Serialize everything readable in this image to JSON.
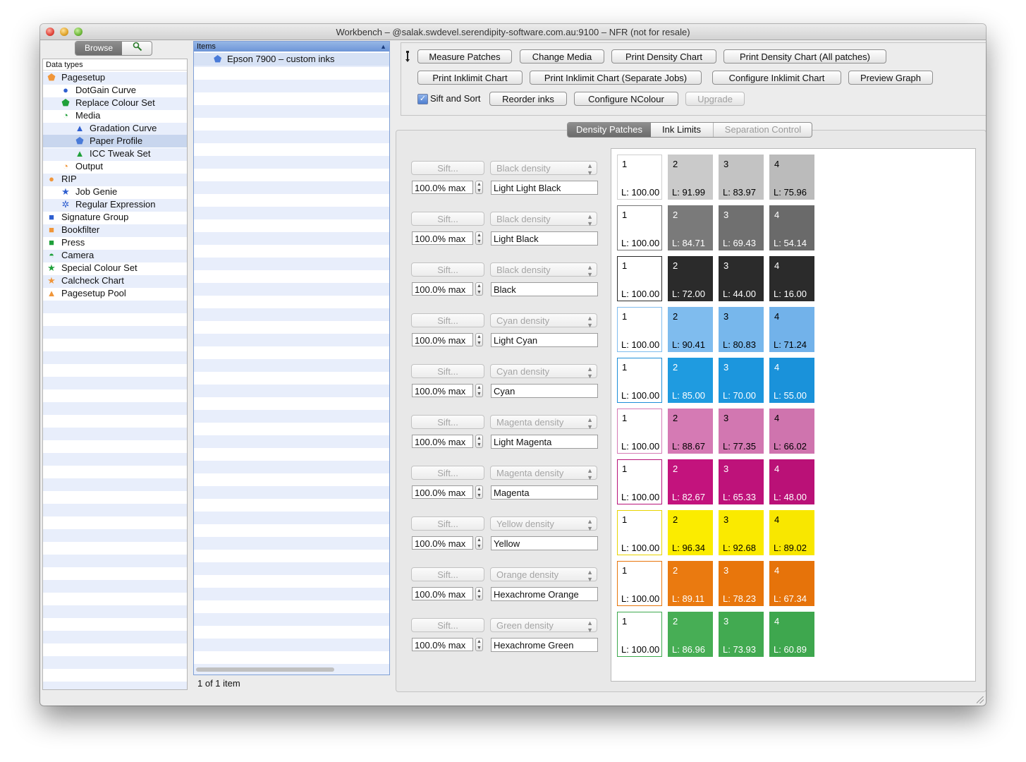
{
  "window": {
    "title": "Workbench – @salak.swdevel.serendipity-software.com.au:9100 – NFR (not for resale)"
  },
  "sidebar": {
    "browse_label": "Browse",
    "search_icon": "magnifier-icon",
    "header": "Data types",
    "items": [
      {
        "label": "Pagesetup",
        "level": 0,
        "icon": "pentagon",
        "color": "#f0963a"
      },
      {
        "label": "DotGain Curve",
        "level": 1,
        "icon": "circle",
        "color": "#2f5fd0"
      },
      {
        "label": "Replace Colour Set",
        "level": 1,
        "icon": "pentagon",
        "color": "#1fa03a"
      },
      {
        "label": "Media",
        "level": 1,
        "icon": "crescent",
        "color": "#1fa03a"
      },
      {
        "label": "Gradation Curve",
        "level": 2,
        "icon": "triangle",
        "color": "#2f5fd0"
      },
      {
        "label": "Paper Profile",
        "level": 2,
        "icon": "pentagon",
        "color": "#4a7bd8",
        "selected": true
      },
      {
        "label": "ICC Tweak Set",
        "level": 2,
        "icon": "triangle",
        "color": "#1fa03a"
      },
      {
        "label": "Output",
        "level": 1,
        "icon": "crescent",
        "color": "#f0963a"
      },
      {
        "label": "RIP",
        "level": 0,
        "icon": "circle",
        "color": "#f0963a"
      },
      {
        "label": "Job Genie",
        "level": 1,
        "icon": "star",
        "color": "#2f5fd0"
      },
      {
        "label": "Regular Expression",
        "level": 1,
        "icon": "asterisk",
        "color": "#2f5fd0"
      },
      {
        "label": "Signature Group",
        "level": 0,
        "icon": "square",
        "color": "#2f5fd0"
      },
      {
        "label": "Bookfilter",
        "level": 0,
        "icon": "square",
        "color": "#f0963a"
      },
      {
        "label": "Press",
        "level": 0,
        "icon": "square",
        "color": "#1fa03a"
      },
      {
        "label": "Camera",
        "level": 0,
        "icon": "half-circle",
        "color": "#1fa03a"
      },
      {
        "label": "Special Colour Set",
        "level": 0,
        "icon": "star",
        "color": "#1fa03a"
      },
      {
        "label": "Calcheck Chart",
        "level": 0,
        "icon": "star",
        "color": "#f0963a"
      },
      {
        "label": "Pagesetup Pool",
        "level": 0,
        "icon": "triangle",
        "color": "#f0963a"
      }
    ]
  },
  "items_pane": {
    "header": "Items",
    "rows": [
      {
        "label": "Epson 7900 – custom inks",
        "icon": "pentagon",
        "color": "#4a7bd8"
      }
    ],
    "count_text": "1 of 1 item"
  },
  "toolbar": {
    "pin_icon": "pin-icon",
    "buttons_row1": [
      "Measure Patches",
      "Change Media",
      "Print Density Chart",
      "Print Density Chart (All patches)"
    ],
    "buttons_row2": [
      "Print Inklimit Chart",
      "Print Inklimit Chart (Separate Jobs)",
      "Configure Inklimit Chart",
      "Preview Graph"
    ],
    "sift_sort_label": "Sift and Sort",
    "sift_sort_checked": true,
    "reorder_label": "Reorder inks",
    "configure_ncolour_label": "Configure NColour",
    "upgrade_label": "Upgrade"
  },
  "tabs": [
    "Density Patches",
    "Ink Limits",
    "Separation Control"
  ],
  "active_tab": "Density Patches",
  "inks": [
    {
      "sift": "Sift...",
      "density": "Black density",
      "max": "100.0% max",
      "name": "Light Light Black",
      "border": "#cfcfcf",
      "patches": [
        {
          "num": "1",
          "l": "L: 100.00",
          "bg": "#ffffff",
          "fg": "#000000"
        },
        {
          "num": "2",
          "l": "L: 91.99",
          "bg": "#cacaca",
          "fg": "#000000"
        },
        {
          "num": "3",
          "l": "L: 83.97",
          "bg": "#c3c3c3",
          "fg": "#000000"
        },
        {
          "num": "4",
          "l": "L: 75.96",
          "bg": "#bbbbbb",
          "fg": "#000000"
        }
      ]
    },
    {
      "sift": "Sift...",
      "density": "Black density",
      "max": "100.0% max",
      "name": "Light Black",
      "border": "#777777",
      "patches": [
        {
          "num": "1",
          "l": "L: 100.00",
          "bg": "#ffffff",
          "fg": "#000000"
        },
        {
          "num": "2",
          "l": "L: 84.71",
          "bg": "#7a7a7a",
          "fg": "#ffffff"
        },
        {
          "num": "3",
          "l": "L: 69.43",
          "bg": "#707070",
          "fg": "#ffffff"
        },
        {
          "num": "4",
          "l": "L: 54.14",
          "bg": "#6a6a6a",
          "fg": "#ffffff"
        }
      ]
    },
    {
      "sift": "Sift...",
      "density": "Black density",
      "max": "100.0% max",
      "name": "Black",
      "border": "#2b2b2b",
      "patches": [
        {
          "num": "1",
          "l": "L: 100.00",
          "bg": "#ffffff",
          "fg": "#000000"
        },
        {
          "num": "2",
          "l": "L: 72.00",
          "bg": "#2b2b2b",
          "fg": "#ffffff"
        },
        {
          "num": "3",
          "l": "L: 44.00",
          "bg": "#2b2b2b",
          "fg": "#ffffff"
        },
        {
          "num": "4",
          "l": "L: 16.00",
          "bg": "#2b2b2b",
          "fg": "#ffffff"
        }
      ]
    },
    {
      "sift": "Sift...",
      "density": "Cyan density",
      "max": "100.0% max",
      "name": "Light Cyan",
      "border": "#7fbcee",
      "patches": [
        {
          "num": "1",
          "l": "L: 100.00",
          "bg": "#ffffff",
          "fg": "#000000"
        },
        {
          "num": "2",
          "l": "L: 90.41",
          "bg": "#7fbcee",
          "fg": "#000000"
        },
        {
          "num": "3",
          "l": "L: 80.83",
          "bg": "#77b7ec",
          "fg": "#000000"
        },
        {
          "num": "4",
          "l": "L: 71.24",
          "bg": "#72b2ea",
          "fg": "#000000"
        }
      ]
    },
    {
      "sift": "Sift...",
      "density": "Cyan density",
      "max": "100.0% max",
      "name": "Cyan",
      "border": "#1e8fd8",
      "patches": [
        {
          "num": "1",
          "l": "L: 100.00",
          "bg": "#ffffff",
          "fg": "#000000"
        },
        {
          "num": "2",
          "l": "L: 85.00",
          "bg": "#1f9be0",
          "fg": "#ffffff"
        },
        {
          "num": "3",
          "l": "L: 70.00",
          "bg": "#1c96dd",
          "fg": "#ffffff"
        },
        {
          "num": "4",
          "l": "L: 55.00",
          "bg": "#1a92da",
          "fg": "#ffffff"
        }
      ]
    },
    {
      "sift": "Sift...",
      "density": "Magenta density",
      "max": "100.0% max",
      "name": "Light Magenta",
      "border": "#d67bb5",
      "patches": [
        {
          "num": "1",
          "l": "L: 100.00",
          "bg": "#ffffff",
          "fg": "#000000"
        },
        {
          "num": "2",
          "l": "L: 88.67",
          "bg": "#d57ab4",
          "fg": "#000000"
        },
        {
          "num": "3",
          "l": "L: 77.35",
          "bg": "#d277b1",
          "fg": "#000000"
        },
        {
          "num": "4",
          "l": "L: 66.02",
          "bg": "#cf74ae",
          "fg": "#000000"
        }
      ]
    },
    {
      "sift": "Sift...",
      "density": "Magenta density",
      "max": "100.0% max",
      "name": "Magenta",
      "border": "#b8137a",
      "patches": [
        {
          "num": "1",
          "l": "L: 100.00",
          "bg": "#ffffff",
          "fg": "#000000"
        },
        {
          "num": "2",
          "l": "L: 82.67",
          "bg": "#c3137d",
          "fg": "#ffffff"
        },
        {
          "num": "3",
          "l": "L: 65.33",
          "bg": "#be127a",
          "fg": "#ffffff"
        },
        {
          "num": "4",
          "l": "L: 48.00",
          "bg": "#ba1177",
          "fg": "#ffffff"
        }
      ]
    },
    {
      "sift": "Sift...",
      "density": "Yellow density",
      "max": "100.0% max",
      "name": "Yellow",
      "border": "#e8d400",
      "patches": [
        {
          "num": "1",
          "l": "L: 100.00",
          "bg": "#ffffff",
          "fg": "#000000"
        },
        {
          "num": "2",
          "l": "L: 96.34",
          "bg": "#fbec00",
          "fg": "#000000"
        },
        {
          "num": "3",
          "l": "L: 92.68",
          "bg": "#faea00",
          "fg": "#000000"
        },
        {
          "num": "4",
          "l": "L: 89.02",
          "bg": "#f8e700",
          "fg": "#000000"
        }
      ]
    },
    {
      "sift": "Sift...",
      "density": "Orange density",
      "max": "100.0% max",
      "name": "Hexachrome Orange",
      "border": "#e8760c",
      "patches": [
        {
          "num": "1",
          "l": "L: 100.00",
          "bg": "#ffffff",
          "fg": "#000000"
        },
        {
          "num": "2",
          "l": "L: 89.11",
          "bg": "#ea7a10",
          "fg": "#ffffff"
        },
        {
          "num": "3",
          "l": "L: 78.23",
          "bg": "#e8760c",
          "fg": "#ffffff"
        },
        {
          "num": "4",
          "l": "L: 67.34",
          "bg": "#e6730a",
          "fg": "#ffffff"
        }
      ]
    },
    {
      "sift": "Sift...",
      "density": "Green density",
      "max": "100.0% max",
      "name": "Hexachrome Green",
      "border": "#3ea94f",
      "patches": [
        {
          "num": "1",
          "l": "L: 100.00",
          "bg": "#ffffff",
          "fg": "#000000"
        },
        {
          "num": "2",
          "l": "L: 86.96",
          "bg": "#47ae55",
          "fg": "#ffffff"
        },
        {
          "num": "3",
          "l": "L: 73.93",
          "bg": "#42aa51",
          "fg": "#ffffff"
        },
        {
          "num": "4",
          "l": "L: 60.89",
          "bg": "#3ea74e",
          "fg": "#ffffff"
        }
      ]
    }
  ]
}
